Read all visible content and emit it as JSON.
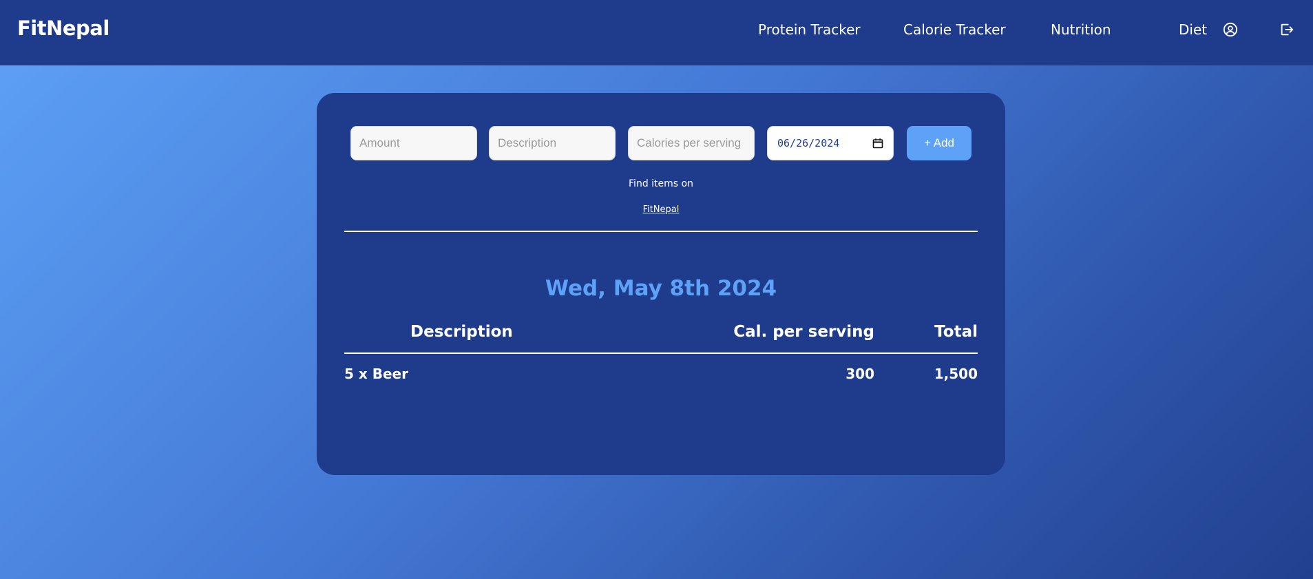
{
  "nav": {
    "brand": "FitNepal",
    "links": [
      "Protein Tracker",
      "Calorie Tracker",
      "Nutrition",
      "Diet"
    ],
    "icons": [
      "user-circle-icon",
      "logout-icon"
    ]
  },
  "form": {
    "amount_placeholder": "Amount",
    "description_placeholder": "Description",
    "calories_placeholder": "Calories per serving",
    "date_value": "06/26/2024",
    "add_label": "+ Add"
  },
  "find": {
    "text": "Find items on",
    "link": "FitNepal"
  },
  "log": {
    "day": "Wed, May 8th 2024",
    "headers": {
      "description": "Description",
      "cal_per_serving": "Cal. per serving",
      "total": "Total"
    },
    "rows": [
      {
        "description": "5 x Beer",
        "cal_per_serving": "300",
        "total": "1,500"
      }
    ]
  },
  "colors": {
    "navbar": "#1f3b8c",
    "card": "#1f3b8c",
    "accent": "#5ea2f7",
    "text": "#ffffff"
  }
}
